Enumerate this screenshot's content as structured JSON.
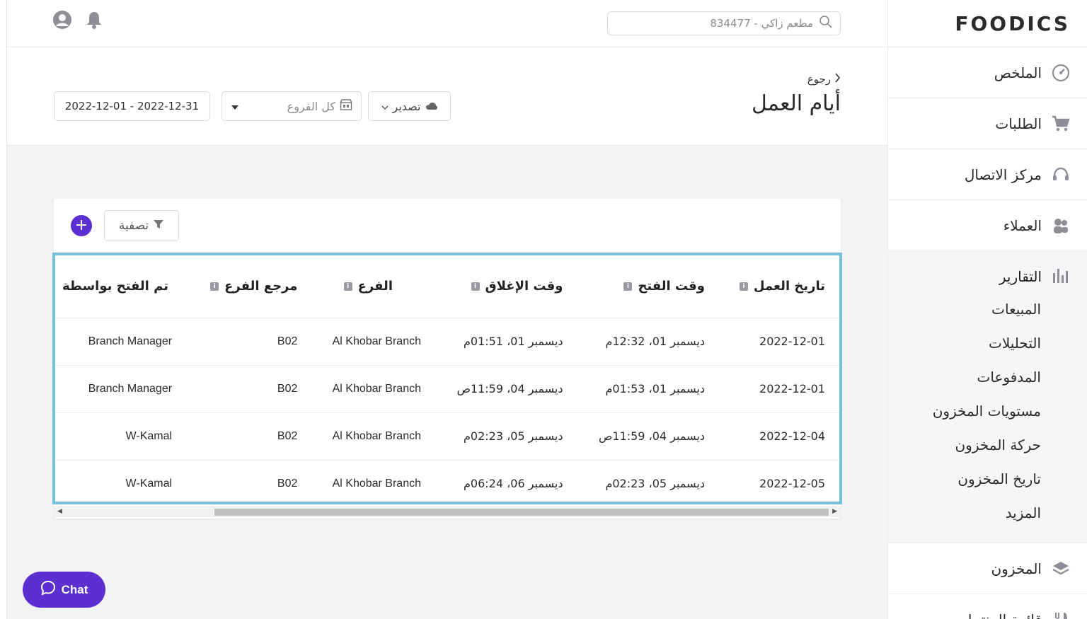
{
  "app": {
    "logo_text": "FOODICS"
  },
  "header": {
    "search_placeholder": "مطعم زاكي - 834477"
  },
  "sidebar": {
    "items": [
      {
        "label": "الملخص",
        "icon": "dashboard-gauge-icon"
      },
      {
        "label": "الطلبات",
        "icon": "cart-icon"
      },
      {
        "label": "مركز الاتصال",
        "icon": "headset-icon"
      },
      {
        "label": "العملاء",
        "icon": "customers-icon"
      }
    ],
    "reports": {
      "label": "التقارير",
      "icon": "bar-chart-icon",
      "sub_items": [
        "المبيعات",
        "التحليلات",
        "المدفوعات",
        "مستويات المخزون",
        "حركة المخزون",
        "تاريخ المخزون",
        "المزيد"
      ]
    },
    "after_items": [
      {
        "label": "المخزون",
        "icon": "layers-icon"
      },
      {
        "label": "قائمة المنتجات",
        "icon": "fork-knife-icon"
      }
    ]
  },
  "page": {
    "back_label": "رجوع",
    "title": "أيام العمل",
    "export_label": "تصدير",
    "branches_placeholder": "كل الفروع",
    "date_range": "2022-12-01 - 2022-12-31"
  },
  "toolbar": {
    "filter_label": "تصفية",
    "add_label": "+"
  },
  "table": {
    "columns": [
      "تاريخ العمل",
      "وقت الفتح",
      "وقت الإغلاق",
      "الفرع",
      "مرجع الفرع",
      "تم الفتح بواسطة"
    ],
    "rows": [
      [
        "2022-12-01",
        "ديسمبر 01، 12:32م",
        "ديسمبر 01، 01:51م",
        "Al Khobar Branch",
        "B02",
        "Branch Manager"
      ],
      [
        "2022-12-01",
        "ديسمبر 01، 01:53م",
        "ديسمبر 04، 11:59ص",
        "Al Khobar Branch",
        "B02",
        "Branch Manager"
      ],
      [
        "2022-12-04",
        "ديسمبر 04، 11:59ص",
        "ديسمبر 05، 02:23م",
        "Al Khobar Branch",
        "B02",
        "W-Kamal"
      ],
      [
        "2022-12-05",
        "ديسمبر 05، 02:23م",
        "ديسمبر 06، 06:24م",
        "Al Khobar Branch",
        "B02",
        "W-Kamal"
      ]
    ]
  },
  "chat": {
    "label": "Chat"
  },
  "colors": {
    "accent": "#5b2fd0",
    "highlight_border": "#79bfd9"
  }
}
